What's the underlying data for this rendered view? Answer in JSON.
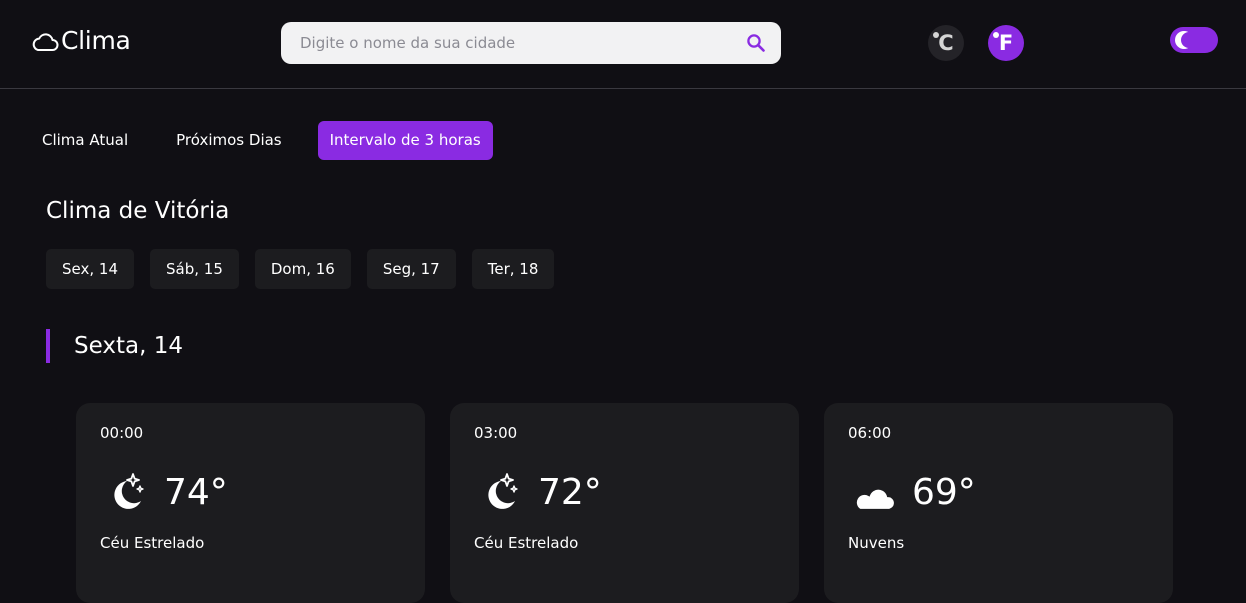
{
  "header": {
    "logo_text": "Clima",
    "logo_icon": "cloud-outline-icon",
    "search_placeholder": "Digite o nome da sua cidade",
    "search_icon": "search-icon",
    "units": [
      {
        "label": "C",
        "icon": "celsius-icon",
        "active": false
      },
      {
        "label": "F",
        "icon": "fahrenheit-icon",
        "active": true
      }
    ],
    "theme_toggle": {
      "icon": "moon-icon",
      "state": "dark"
    }
  },
  "tabs": [
    {
      "label": "Clima Atual",
      "active": false
    },
    {
      "label": "Próximos Dias",
      "active": false
    },
    {
      "label": "Intervalo de 3 horas",
      "active": true
    }
  ],
  "city_title": "Clima de Vitória",
  "days": [
    "Sex, 14",
    "Sáb, 15",
    "Dom, 16",
    "Seg, 17",
    "Ter, 18"
  ],
  "section_title": "Sexta, 14",
  "cards": [
    {
      "time": "00:00",
      "temp": "74°",
      "desc": "Céu Estrelado",
      "icon": "moon-stars-icon"
    },
    {
      "time": "03:00",
      "temp": "72°",
      "desc": "Céu Estrelado",
      "icon": "moon-stars-icon"
    },
    {
      "time": "06:00",
      "temp": "69°",
      "desc": "Nuvens",
      "icon": "moon-cloud-icon"
    }
  ],
  "colors": {
    "background": "#100f14",
    "accent": "#8a2be2",
    "surface": "#1c1c1f"
  }
}
